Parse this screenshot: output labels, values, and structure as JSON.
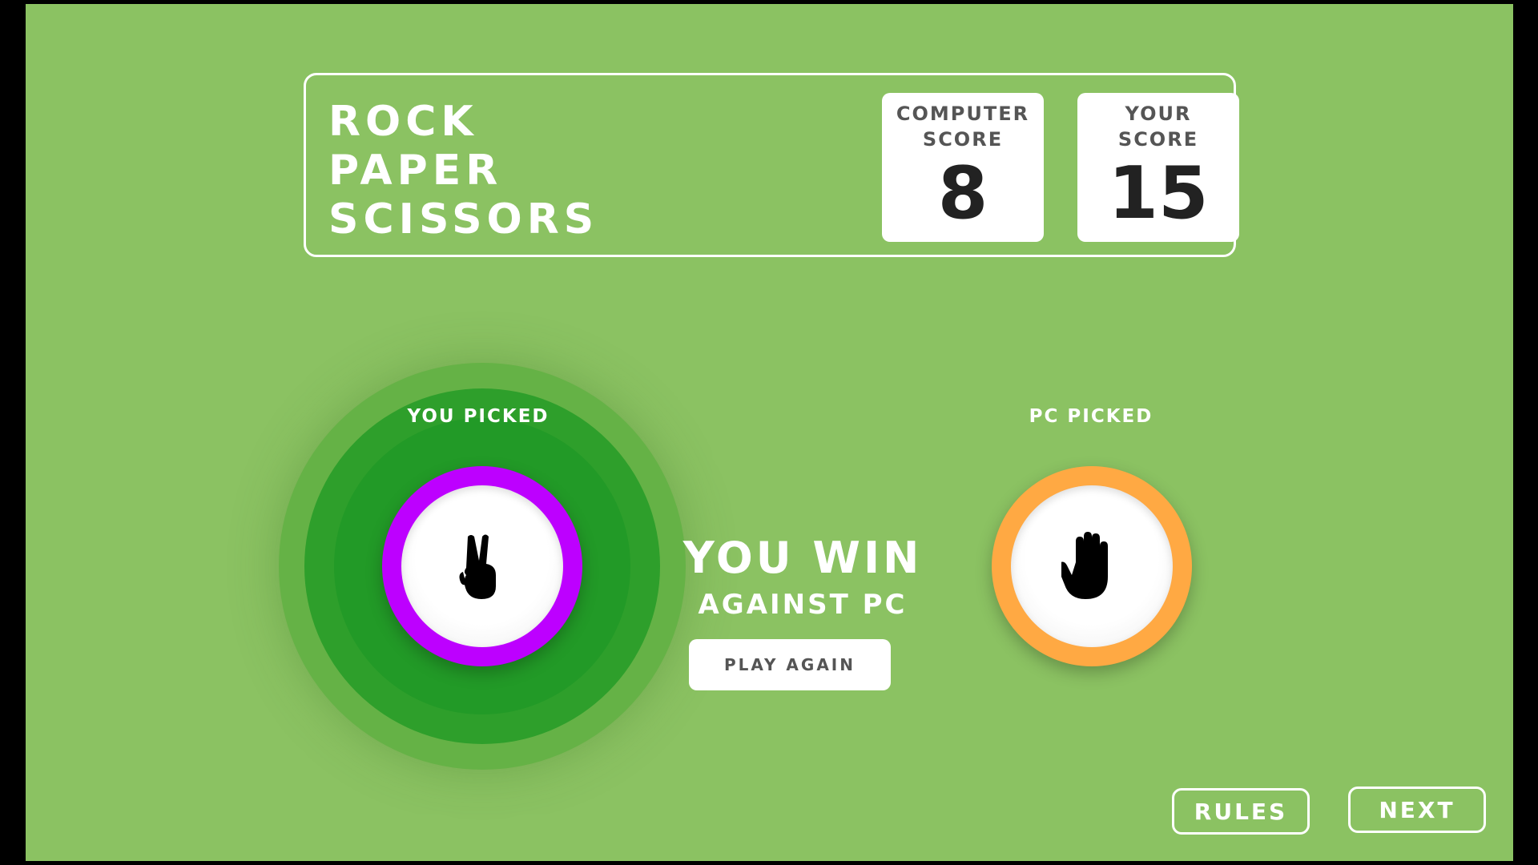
{
  "header": {
    "title_lines": [
      "ROCK",
      "PAPER",
      "SCISSORS"
    ],
    "computer_score": {
      "label": "COMPUTER SCORE",
      "value": "8"
    },
    "your_score": {
      "label": "YOUR SCORE",
      "value": "15"
    }
  },
  "game": {
    "you_label": "YOU PICKED",
    "pc_label": "PC PICKED",
    "you_pick": {
      "choice": "scissors",
      "icon": "scissors-hand-icon",
      "ring_color": "#BD00FF"
    },
    "pc_pick": {
      "choice": "paper",
      "icon": "paper-hand-icon",
      "ring_color": "#FFA943"
    },
    "result_main": "YOU WIN",
    "result_sub": "AGAINST PC",
    "play_again_label": "PLAY AGAIN"
  },
  "footer": {
    "rules_label": "RULES",
    "next_label": "NEXT"
  },
  "colors": {
    "background": "#8BC262",
    "winner_halo": "#229A27"
  }
}
